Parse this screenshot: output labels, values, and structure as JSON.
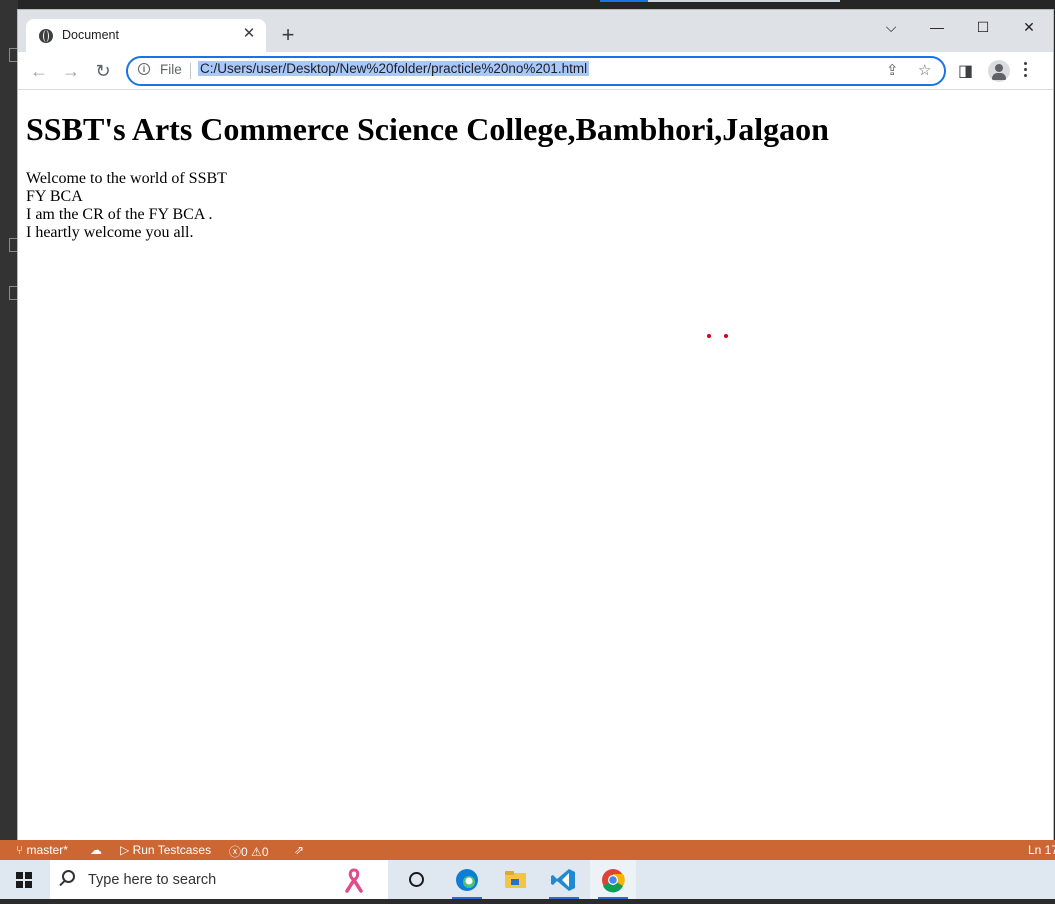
{
  "browser": {
    "tab": {
      "title": "Document",
      "close": "✕"
    },
    "new_tab": "+",
    "window_controls": {
      "dropdown": "⌵",
      "minimize": "—",
      "maximize": "☐",
      "close": "✕"
    },
    "nav": {
      "back": "←",
      "forward": "→",
      "reload": "↻"
    },
    "omnibox": {
      "scheme_label": "File",
      "url": "C:/Users/user/Desktop/New%20folder/practicle%20no%201.html"
    }
  },
  "page": {
    "heading": "SSBT's Arts Commerce Science College,Bambhori,Jalgaon",
    "lines": [
      "Welcome to the world of SSBT",
      "FY BCA",
      "I am the CR of the FY BCA .",
      "I heartly welcome you all."
    ]
  },
  "statusbar": {
    "branch": "master*",
    "run_testcases": "Run Testcases",
    "errors": "0",
    "warnings": "0",
    "position": "Ln 17"
  },
  "taskbar": {
    "search_placeholder": "Type here to search"
  },
  "colors": {
    "omnibox_focus": "#1a73e8",
    "url_highlight": "#a8c7fa",
    "statusbar": "#cc6633"
  }
}
